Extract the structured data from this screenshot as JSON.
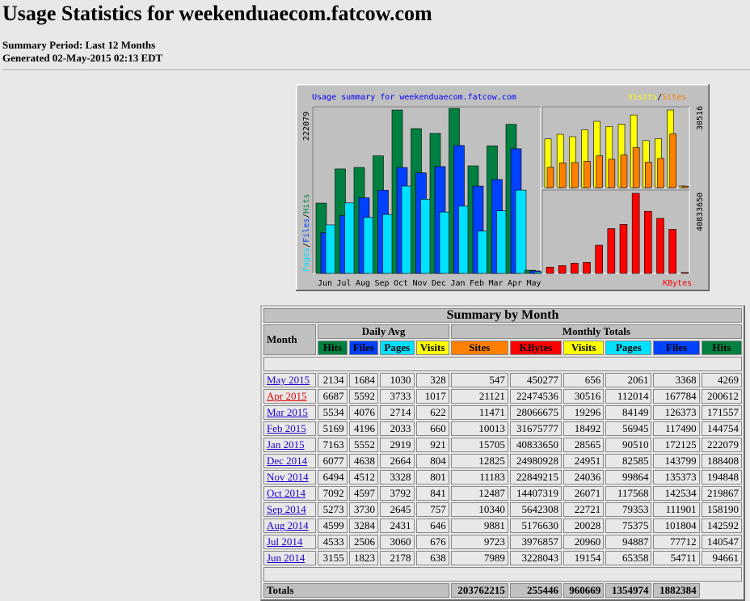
{
  "header": {
    "title": "Usage Statistics for weekenduaecom.fatcow.com",
    "summary_period": "Summary Period: Last 12 Months",
    "generated": "Generated 02-May-2015 02:13 EDT"
  },
  "colors": {
    "hits": "#008040",
    "files": "#0040ff",
    "pages": "#00e0ff",
    "visits": "#ffff00",
    "sites": "#ff8000",
    "kbytes": "#ff0000",
    "chart_bg": "#c0c0c0",
    "graph_title": "#0000ff"
  },
  "graph": {
    "title": "Usage summary for weekenduaecom.fatcow.com",
    "left_axis_max": "222079",
    "left_axis_label": {
      "pages": "Pages",
      "files": "Files",
      "hits": "Hits"
    },
    "right_top_max": "30516",
    "right_top_label": {
      "visits": "Visits",
      "sites": "Sites"
    },
    "right_bottom_max": "40833650",
    "right_bottom_label": "KBytes",
    "months": [
      "Jun",
      "Jul",
      "Aug",
      "Sep",
      "Oct",
      "Nov",
      "Dec",
      "Jan",
      "Feb",
      "Mar",
      "Apr",
      "May"
    ]
  },
  "chart_data": {
    "type": "bar",
    "title": "Usage summary for weekenduaecom.fatcow.com",
    "categories": [
      "Jun",
      "Jul",
      "Aug",
      "Sep",
      "Oct",
      "Nov",
      "Dec",
      "Jan",
      "Feb",
      "Mar",
      "Apr",
      "May"
    ],
    "series": [
      {
        "name": "Hits",
        "values": [
          94661,
          140547,
          142592,
          158190,
          219867,
          194848,
          188408,
          222079,
          144754,
          171557,
          200612,
          4269
        ]
      },
      {
        "name": "Files",
        "values": [
          54711,
          77712,
          101804,
          111901,
          142534,
          135373,
          143799,
          172125,
          117490,
          126373,
          167784,
          3368
        ]
      },
      {
        "name": "Pages",
        "values": [
          65358,
          94887,
          75375,
          79353,
          117568,
          99864,
          82585,
          90510,
          56945,
          84149,
          112014,
          2061
        ]
      },
      {
        "name": "Visits",
        "values": [
          19154,
          20960,
          20028,
          22721,
          26071,
          24036,
          24951,
          28565,
          18492,
          19296,
          30516,
          656
        ]
      },
      {
        "name": "Sites",
        "values": [
          7989,
          9723,
          9881,
          10340,
          12487,
          11183,
          12825,
          15705,
          10013,
          11471,
          21121,
          547
        ]
      },
      {
        "name": "KBytes",
        "values": [
          3228043,
          3976857,
          5176630,
          5642308,
          14407319,
          22849215,
          24980928,
          40833650,
          31675777,
          28066675,
          22474536,
          450277
        ]
      }
    ]
  },
  "table": {
    "caption": "Summary by Month",
    "month_header": "Month",
    "daily_avg_header": "Daily Avg",
    "monthly_totals_header": "Monthly Totals",
    "columns": [
      "Hits",
      "Files",
      "Pages",
      "Visits",
      "Sites",
      "KBytes",
      "Visits",
      "Pages",
      "Files",
      "Hits"
    ],
    "rows": [
      {
        "month": "May 2015",
        "cells": [
          "2134",
          "1684",
          "1030",
          "328",
          "547",
          "450277",
          "656",
          "2061",
          "3368",
          "4269"
        ]
      },
      {
        "month": "Apr 2015",
        "cells": [
          "6687",
          "5592",
          "3733",
          "1017",
          "21121",
          "22474536",
          "30516",
          "112014",
          "167784",
          "200612"
        ]
      },
      {
        "month": "Mar 2015",
        "cells": [
          "5534",
          "4076",
          "2714",
          "622",
          "11471",
          "28066675",
          "19296",
          "84149",
          "126373",
          "171557"
        ]
      },
      {
        "month": "Feb 2015",
        "cells": [
          "5169",
          "4196",
          "2033",
          "660",
          "10013",
          "31675777",
          "18492",
          "56945",
          "117490",
          "144754"
        ]
      },
      {
        "month": "Jan 2015",
        "cells": [
          "7163",
          "5552",
          "2919",
          "921",
          "15705",
          "40833650",
          "28565",
          "90510",
          "172125",
          "222079"
        ]
      },
      {
        "month": "Dec 2014",
        "cells": [
          "6077",
          "4638",
          "2664",
          "804",
          "12825",
          "24980928",
          "24951",
          "82585",
          "143799",
          "188408"
        ]
      },
      {
        "month": "Nov 2014",
        "cells": [
          "6494",
          "4512",
          "3328",
          "801",
          "11183",
          "22849215",
          "24036",
          "99864",
          "135373",
          "194848"
        ]
      },
      {
        "month": "Oct 2014",
        "cells": [
          "7092",
          "4597",
          "3792",
          "841",
          "12487",
          "14407319",
          "26071",
          "117568",
          "142534",
          "219867"
        ]
      },
      {
        "month": "Sep 2014",
        "cells": [
          "5273",
          "3730",
          "2645",
          "757",
          "10340",
          "5642308",
          "22721",
          "79353",
          "111901",
          "158190"
        ]
      },
      {
        "month": "Aug 2014",
        "cells": [
          "4599",
          "3284",
          "2431",
          "646",
          "9881",
          "5176630",
          "20028",
          "75375",
          "101804",
          "142592"
        ]
      },
      {
        "month": "Jul 2014",
        "cells": [
          "4533",
          "2506",
          "3060",
          "676",
          "9723",
          "3976857",
          "20960",
          "94887",
          "77712",
          "140547"
        ]
      },
      {
        "month": "Jun 2014",
        "cells": [
          "3155",
          "1823",
          "2178",
          "638",
          "7989",
          "3228043",
          "19154",
          "65358",
          "54711",
          "94661"
        ]
      }
    ],
    "totals": {
      "label": "Totals",
      "kbytes": "203762215",
      "visits": "255446",
      "pages": "960669",
      "files": "1354974",
      "hits": "1882384"
    }
  }
}
